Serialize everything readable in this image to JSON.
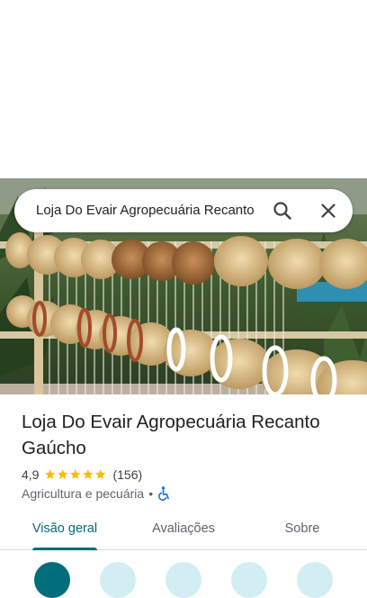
{
  "search": {
    "query": "Loja Do Evair Agropecuária Recanto"
  },
  "icons": {
    "search": "search-icon",
    "close": "close-icon",
    "star": "star-icon",
    "accessibility": "wheelchair-icon"
  },
  "place": {
    "title": "Loja Do Evair Agropecuária Recanto Gaúcho",
    "rating": "4,9",
    "stars": 5,
    "review_count": "(156)",
    "category": "Agricultura e pecuária",
    "separator": "•"
  },
  "tabs": [
    {
      "label": "Visão geral",
      "active": true
    },
    {
      "label": "Avaliações",
      "active": false
    },
    {
      "label": "Sobre",
      "active": false
    }
  ],
  "colors": {
    "accent": "#006d7a",
    "star": "#fbbc04",
    "accessibility": "#1a73e8",
    "action_bg": "#d3eef2"
  }
}
